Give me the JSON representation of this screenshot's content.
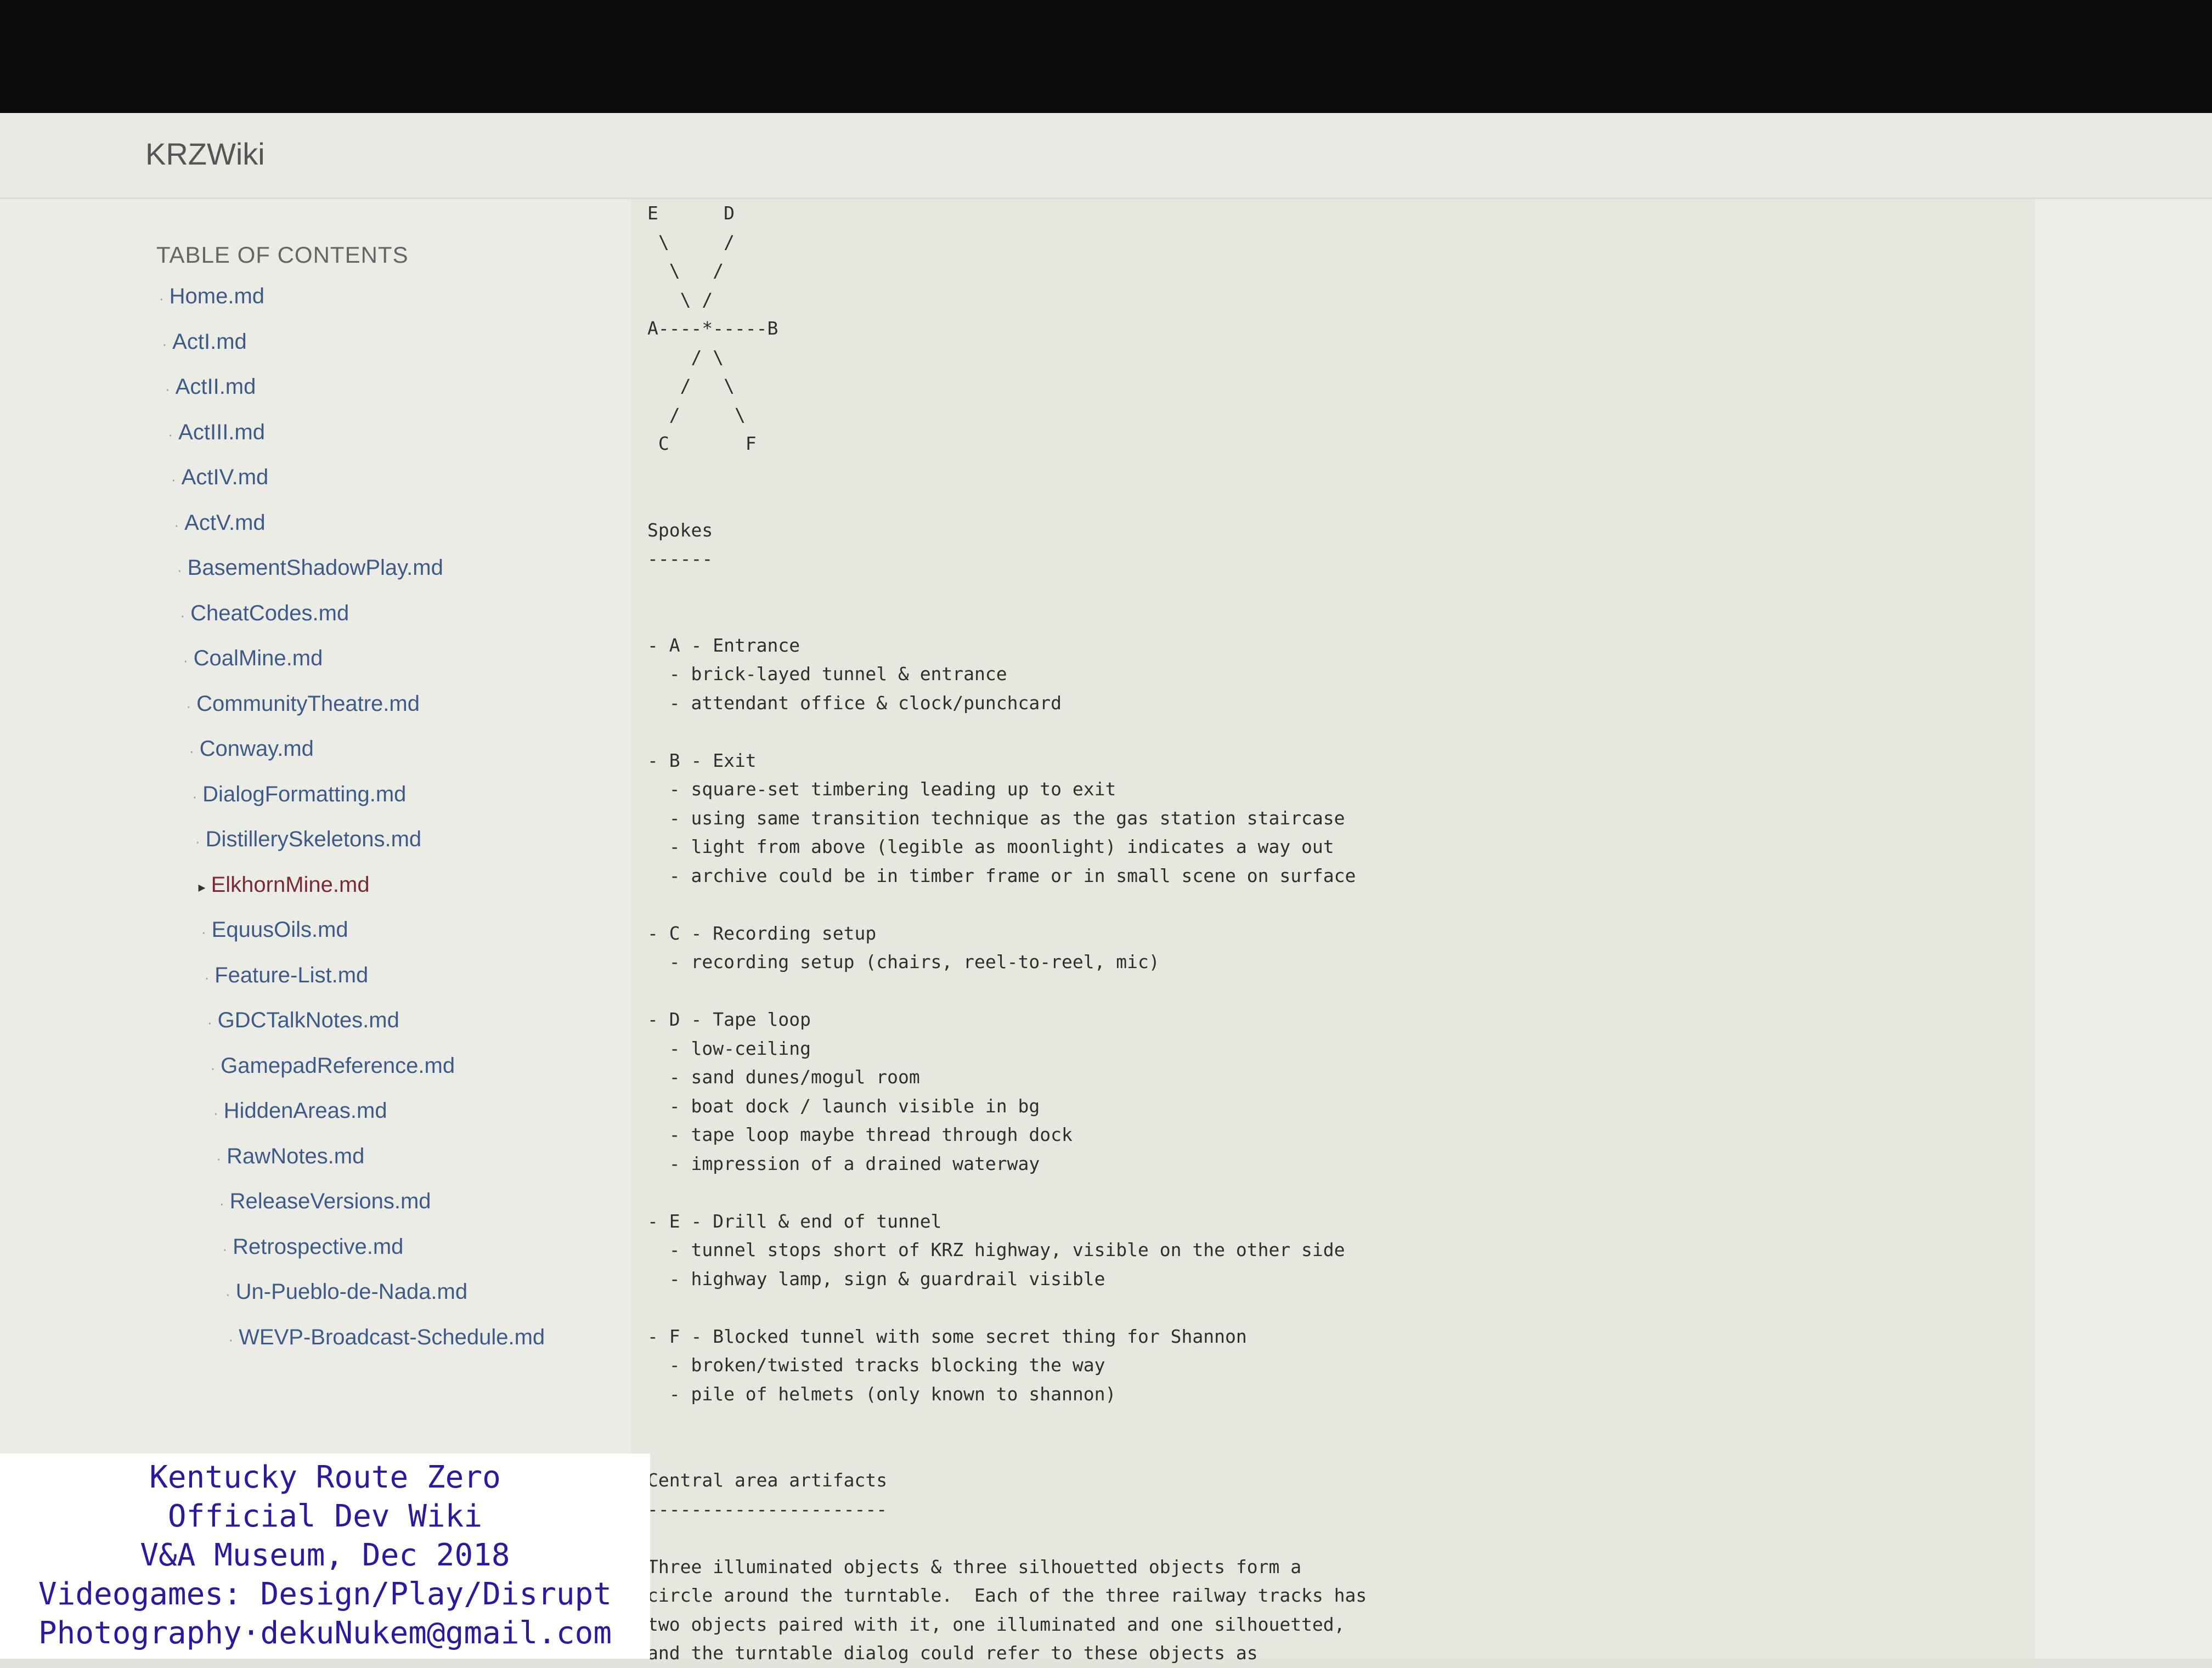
{
  "header": {
    "brand": "KRZWiki"
  },
  "sidebar": {
    "toc_title": "TABLE OF CONTENTS",
    "items": [
      {
        "label": "Home.md"
      },
      {
        "label": "ActI.md"
      },
      {
        "label": "ActII.md"
      },
      {
        "label": "ActIII.md"
      },
      {
        "label": "ActIV.md"
      },
      {
        "label": "ActV.md"
      },
      {
        "label": "BasementShadowPlay.md"
      },
      {
        "label": "CheatCodes.md"
      },
      {
        "label": "CoalMine.md"
      },
      {
        "label": "CommunityTheatre.md"
      },
      {
        "label": "Conway.md"
      },
      {
        "label": "DialogFormatting.md"
      },
      {
        "label": "DistillerySkeletons.md"
      },
      {
        "label": "ElkhornMine.md",
        "active": true
      },
      {
        "label": "EquusOils.md"
      },
      {
        "label": "Feature-List.md"
      },
      {
        "label": "GDCTalkNotes.md"
      },
      {
        "label": "GamepadReference.md"
      },
      {
        "label": "HiddenAreas.md"
      },
      {
        "label": "RawNotes.md"
      },
      {
        "label": "ReleaseVersions.md"
      },
      {
        "label": "Retrospective.md"
      },
      {
        "label": "Un-Pueblo-de-Nada.md"
      },
      {
        "label": "WEVP-Broadcast-Schedule.md"
      }
    ]
  },
  "document": {
    "lines": [
      "E      D",
      " \\     /",
      "  \\   /",
      "   \\ /",
      "A----*-----B",
      "    / \\",
      "   /   \\",
      "  /     \\",
      " C       F",
      "",
      "",
      "Spokes",
      "------",
      "",
      "",
      "- A - Entrance",
      "  - brick-layed tunnel & entrance",
      "  - attendant office & clock/punchcard",
      "",
      "- B - Exit",
      "  - square-set timbering leading up to exit",
      "  - using same transition technique as the gas station staircase",
      "  - light from above (legible as moonlight) indicates a way out",
      "  - archive could be in timber frame or in small scene on surface",
      "",
      "- C - Recording setup",
      "  - recording setup (chairs, reel-to-reel, mic)",
      "",
      "- D - Tape loop",
      "  - low-ceiling",
      "  - sand dunes/mogul room",
      "  - boat dock / launch visible in bg",
      "  - tape loop maybe thread through dock",
      "  - impression of a drained waterway",
      "",
      "- E - Drill & end of tunnel",
      "  - tunnel stops short of KRZ highway, visible on the other side",
      "  - highway lamp, sign & guardrail visible",
      "",
      "- F - Blocked tunnel with some secret thing for Shannon",
      "  - broken/twisted tracks blocking the way",
      "  - pile of helmets (only known to shannon)",
      "",
      "",
      "Central area artifacts",
      "----------------------",
      "",
      "Three illuminated objects & three silhouetted objects form a",
      "circle around the turntable.  Each of the three railway tracks has",
      "two objects paired with it, one illuminated and one silhouetted,",
      "and the turntable dialog could refer to these objects as"
    ]
  },
  "watermark": {
    "lines": [
      "Kentucky Route Zero",
      "Official Dev Wiki",
      "V&A Museum, Dec 2018",
      "Videogames: Design/Play/Disrupt",
      "Photography·dekuNukem@gmail.com"
    ]
  }
}
